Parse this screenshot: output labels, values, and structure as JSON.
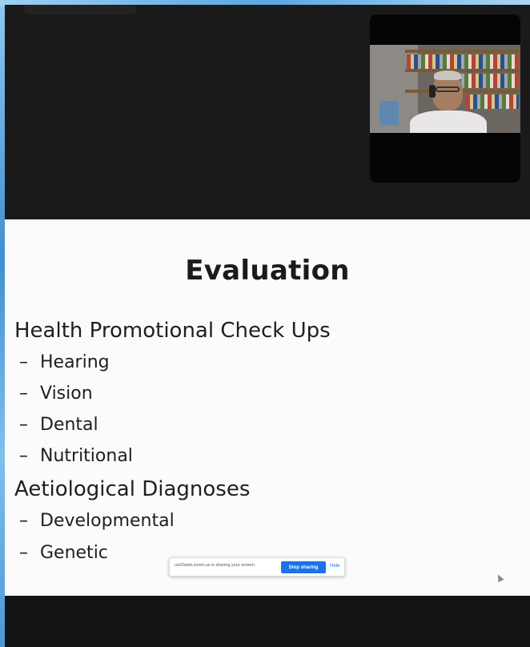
{
  "slide": {
    "title": "Evaluation",
    "sections": [
      {
        "heading": "Health Promotional Check Ups",
        "items": [
          "Hearing",
          "Vision",
          "Dental",
          "Nutritional"
        ]
      },
      {
        "heading": "Aetiological Diagnoses",
        "items": [
          "Developmental",
          "Genetic"
        ]
      }
    ],
    "dash": "–"
  },
  "share_bar": {
    "message": "us02web.zoom.us is sharing your screen.",
    "stop_label": "Stop sharing",
    "hide_label": "Hide"
  },
  "colors": {
    "slide_bg": "#fbfbfd",
    "meeting_bg": "#141414",
    "accent": "#1a73e8"
  }
}
